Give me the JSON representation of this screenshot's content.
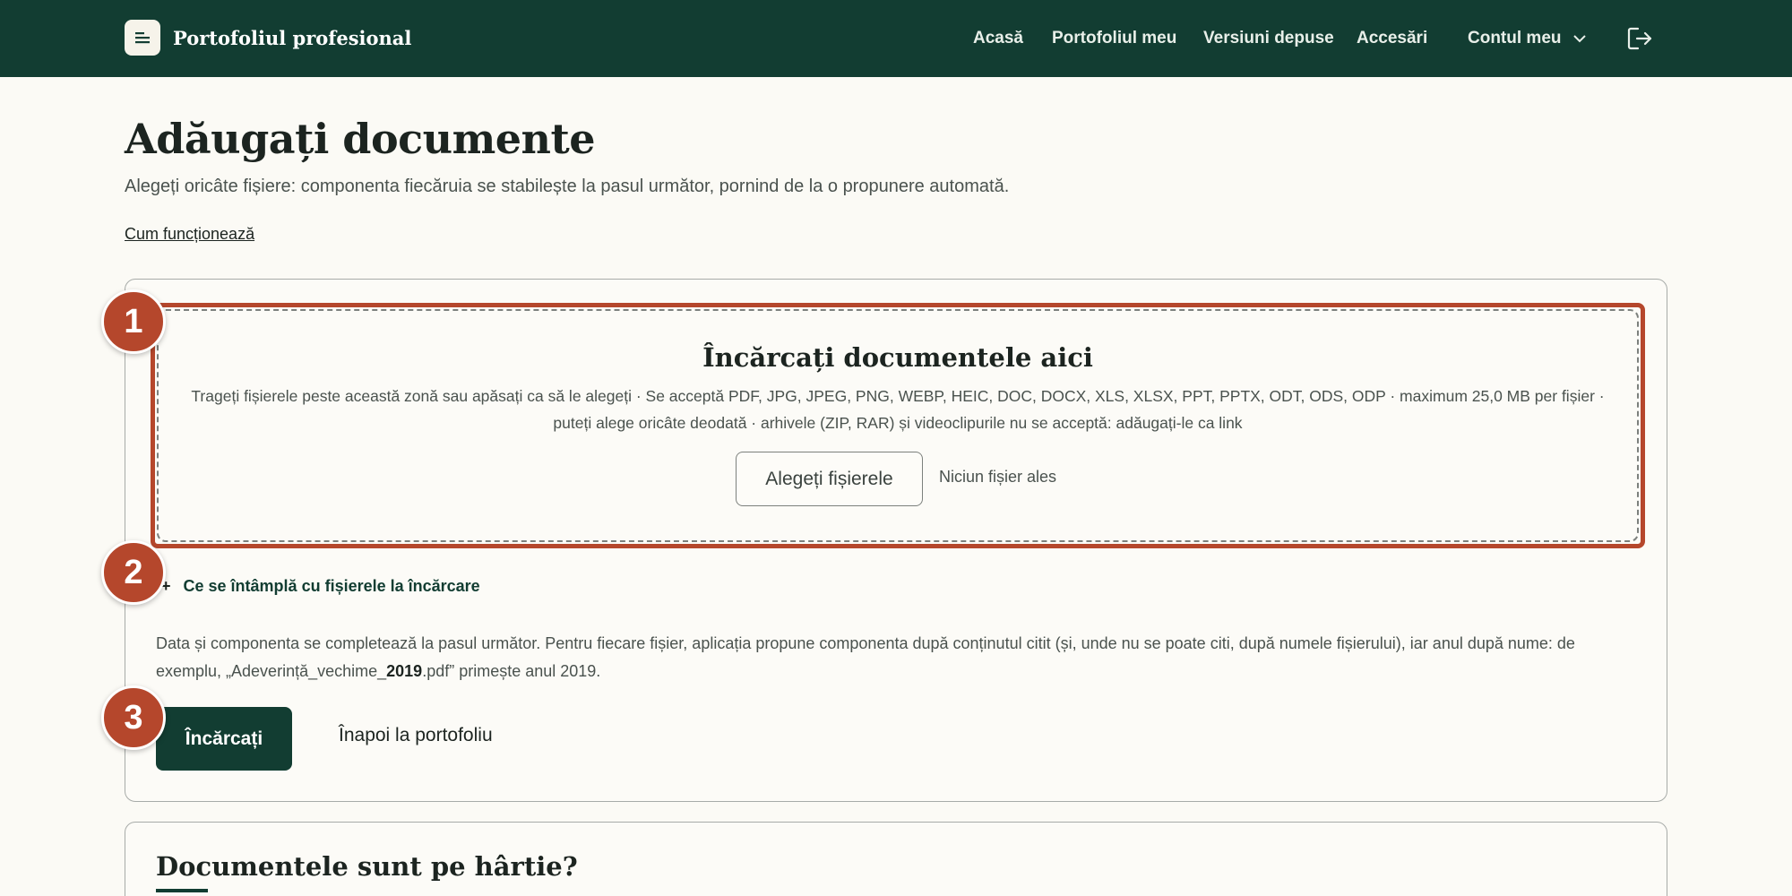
{
  "header": {
    "app_title": "Portofoliul profesional",
    "nav": [
      "Acasă",
      "Portofoliul meu",
      "Versiuni depuse",
      "Accesări"
    ],
    "account_label": "Contul meu",
    "logo_icon": "document-icon",
    "logout_icon": "logout-icon"
  },
  "page": {
    "title": "Adăugați documente",
    "subtitle": "Alegeți oricâte fișiere: componenta fiecăruia se stabilește la pasul următor, pornind de la o propunere automată.",
    "how_link": "Cum funcționează"
  },
  "upload": {
    "title": "Încărcați documentele aici",
    "description": "Trageți fișierele peste această zonă sau apăsați ca să le alegeți · Se acceptă PDF, JPG, JPEG, PNG, WEBP, HEIC, DOC, DOCX, XLS, XLSX, PPT, PPTX, ODT, ODS, ODP · maximum 25,0 MB per fișier · puteți alege oricâte deodată · arhivele (ZIP, RAR) și videoclipurile nu se acceptă: adăugați-le ca link",
    "choose_button": "Alegeți fișierele",
    "no_file": "Niciun fișier ales"
  },
  "details": {
    "toggle_label": "Ce se întâmplă cu fișierele la încărcare",
    "text_before": "Data și componenta se completează la pasul următor. Pentru fiecare fișier, aplicația propune componenta după conținutul citit (și, unde nu se poate citi, după numele fișierului), iar anul după nume: de exemplu, „Adeverință_vechime_",
    "text_bold": "2019",
    "text_after": ".pdf” primește anul 2019."
  },
  "actions": {
    "upload_button": "Încărcați",
    "back_link": "Înapoi la portofoliu"
  },
  "badges": [
    "1",
    "2",
    "3"
  ],
  "paper_section": {
    "title": "Documentele sunt pe hârtie?"
  },
  "colors": {
    "header_bg": "#123d32",
    "accent": "#b5472c",
    "page_bg": "#fbfaf5"
  }
}
